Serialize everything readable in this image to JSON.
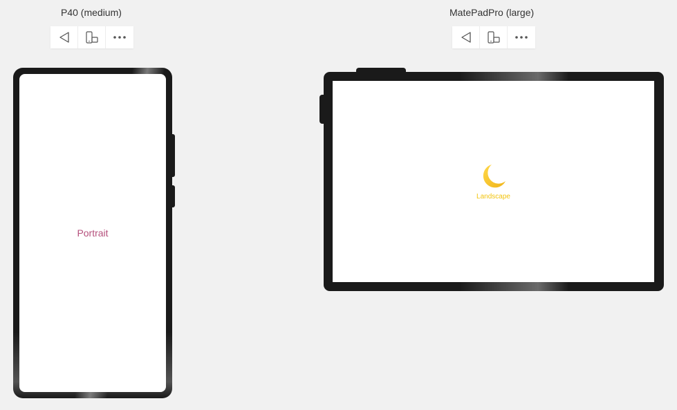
{
  "devices": {
    "phone": {
      "title": "P40 (medium)",
      "screen_text": "Portrait",
      "screen_text_color": "#b5507c",
      "toolbar_icons": [
        "back-triangle-icon",
        "rotate-device-icon",
        "more-dots-icon"
      ]
    },
    "tablet": {
      "title": "MatePadPro (large)",
      "screen_text": "Landscape",
      "screen_text_color": "#f2c40e",
      "screen_icon": "moon-icon",
      "toolbar_icons": [
        "back-triangle-icon",
        "rotate-device-icon",
        "more-dots-icon"
      ]
    }
  },
  "colors": {
    "background": "#f1f1f1",
    "bezel": "#1a1a1a",
    "moon": "#f7c22b"
  }
}
